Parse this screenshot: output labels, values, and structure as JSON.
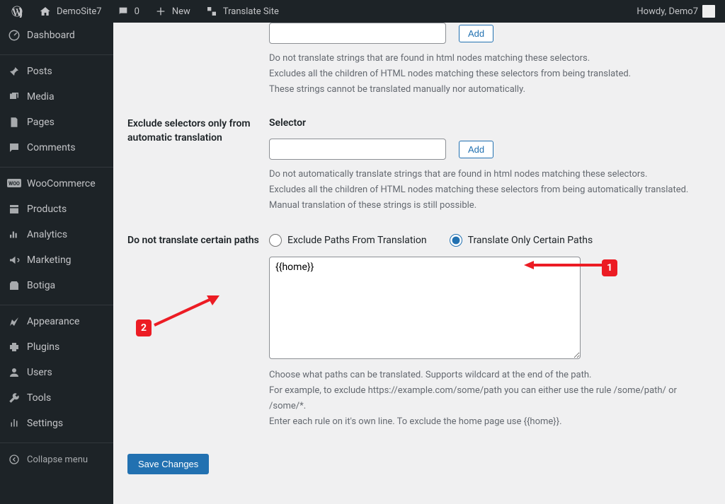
{
  "admin_bar": {
    "site_name": "DemoSite7",
    "comments_count": "0",
    "new_label": "New",
    "translate_label": "Translate Site",
    "howdy": "Howdy, Demo7"
  },
  "sidebar": {
    "items": [
      {
        "label": "Dashboard",
        "icon": "dashboard"
      },
      {
        "label": "Posts",
        "icon": "pin"
      },
      {
        "label": "Media",
        "icon": "media"
      },
      {
        "label": "Pages",
        "icon": "pages"
      },
      {
        "label": "Comments",
        "icon": "comments"
      },
      {
        "label": "WooCommerce",
        "icon": "woo"
      },
      {
        "label": "Products",
        "icon": "products"
      },
      {
        "label": "Analytics",
        "icon": "analytics"
      },
      {
        "label": "Marketing",
        "icon": "marketing"
      },
      {
        "label": "Botiga",
        "icon": "botiga"
      },
      {
        "label": "Appearance",
        "icon": "appearance"
      },
      {
        "label": "Plugins",
        "icon": "plugins"
      },
      {
        "label": "Users",
        "icon": "users"
      },
      {
        "label": "Tools",
        "icon": "tools"
      },
      {
        "label": "Settings",
        "icon": "settings"
      }
    ],
    "collapse": "Collapse menu"
  },
  "sections": {
    "exclude_selectors": {
      "label": "",
      "add_button": "Add",
      "help1": "Do not translate strings that are found in html nodes matching these selectors.",
      "help2": "Excludes all the children of HTML nodes matching these selectors from being translated.",
      "help3": "These strings cannot be translated manually nor automatically."
    },
    "exclude_auto": {
      "label": "Exclude selectors only from automatic translation",
      "selector_heading": "Selector",
      "add_button": "Add",
      "help1": "Do not automatically translate strings that are found in html nodes matching these selectors.",
      "help2": "Excludes all the children of HTML nodes matching these selectors from being automatically translated.",
      "help3": "Manual translation of these strings is still possible."
    },
    "paths": {
      "label": "Do not translate certain paths",
      "radio_exclude": "Exclude Paths From Translation",
      "radio_only": "Translate Only Certain Paths",
      "textarea_value": "{{home}}",
      "help1": "Choose what paths can be translated. Supports wildcard at the end of the path.",
      "help2": "For example, to exclude https://example.com/some/path you can either use the rule /some/path/ or /some/*.",
      "help3": "Enter each rule on it's own line. To exclude the home page use {{home}}."
    },
    "save_button": "Save Changes"
  },
  "annotations": {
    "marker1": "1",
    "marker2": "2"
  }
}
